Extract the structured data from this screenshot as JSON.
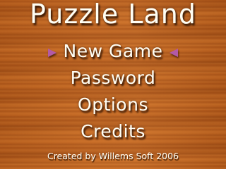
{
  "game": {
    "title": "Puzzle Land"
  },
  "menu": {
    "items": [
      {
        "label": "New Game",
        "selected": true
      },
      {
        "label": "Password",
        "selected": false
      },
      {
        "label": "Options",
        "selected": false
      },
      {
        "label": "Credits",
        "selected": false
      }
    ],
    "selector_icon": "triangle-pointer-icon",
    "selector_color": "#b25aa6"
  },
  "footer": {
    "credit": "Created by Willems Soft 2006"
  },
  "colors": {
    "background": "#c2641f",
    "text": "#fffef4"
  }
}
